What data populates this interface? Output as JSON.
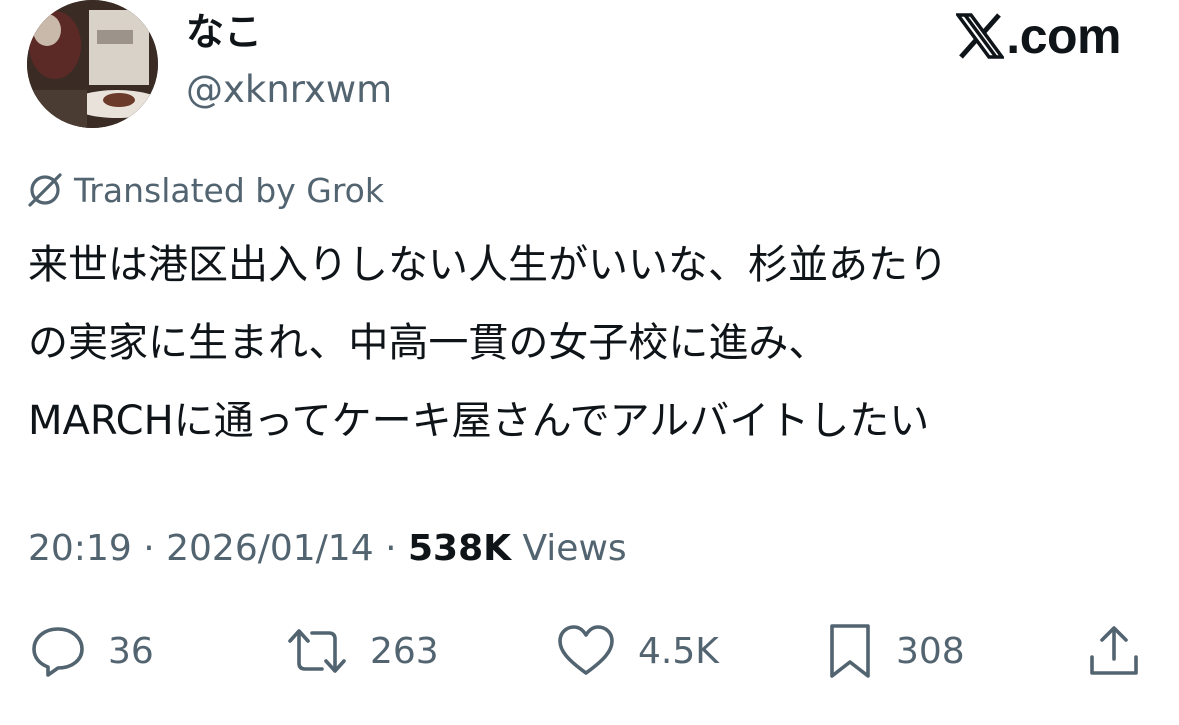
{
  "author": {
    "display_name": "なこ",
    "handle": "@xknrxwm",
    "avatar_icon": "avatar-photo"
  },
  "brand": {
    "text": ".com",
    "logo_icon": "x-logo-icon"
  },
  "translation": {
    "label": "Translated by Grok",
    "icon": "grok-icon"
  },
  "tweet": {
    "lines": [
      "来世は港区出入りしない人生がいいな、杉並あたり",
      "の実家に生まれ、中高一貫の女子校に進み、",
      "MARCHに通ってケーキ屋さんでアルバイトしたい"
    ]
  },
  "meta": {
    "time": "20:19",
    "separator": "·",
    "date": "2026/01/14",
    "views_count": "538K",
    "views_label": "Views"
  },
  "actions": {
    "reply_count": "36",
    "repost_count": "263",
    "like_count": "4.5K",
    "bookmark_count": "308"
  },
  "colors": {
    "text_primary": "#0f1419",
    "text_secondary": "#536471",
    "background": "#ffffff"
  }
}
